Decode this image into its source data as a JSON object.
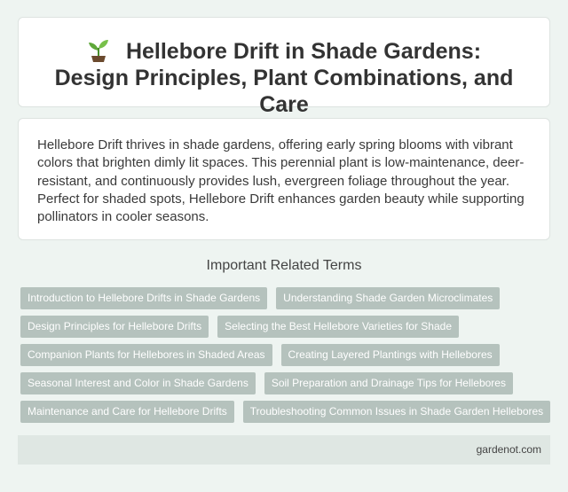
{
  "header": {
    "icon": "seedling-icon",
    "title": "Hellebore Drift in Shade Gardens: Design Principles, Plant Combinations, and Care"
  },
  "description": "Hellebore Drift thrives in shade gardens, offering early spring blooms with vibrant colors that brighten dimly lit spaces. This perennial plant is low-maintenance, deer-resistant, and continuously provides lush, evergreen foliage throughout the year. Perfect for shaded spots, Hellebore Drift enhances garden beauty while supporting pollinators in cooler seasons.",
  "related": {
    "heading": "Important Related Terms",
    "tags": [
      "Introduction to Hellebore Drifts in Shade Gardens",
      "Understanding Shade Garden Microclimates",
      "Design Principles for Hellebore Drifts",
      "Selecting the Best Hellebore Varieties for Shade",
      "Companion Plants for Hellebores in Shaded Areas",
      "Creating Layered Plantings with Hellebores",
      "Seasonal Interest and Color in Shade Gardens",
      "Soil Preparation and Drainage Tips for Hellebores",
      "Maintenance and Care for Hellebore Drifts",
      "Troubleshooting Common Issues in Shade Garden Hellebores"
    ]
  },
  "footer": {
    "site": "gardenot.com"
  },
  "colors": {
    "background": "#eef4f1",
    "tag": "#b5c2bd",
    "footer": "#dfe7e3"
  }
}
